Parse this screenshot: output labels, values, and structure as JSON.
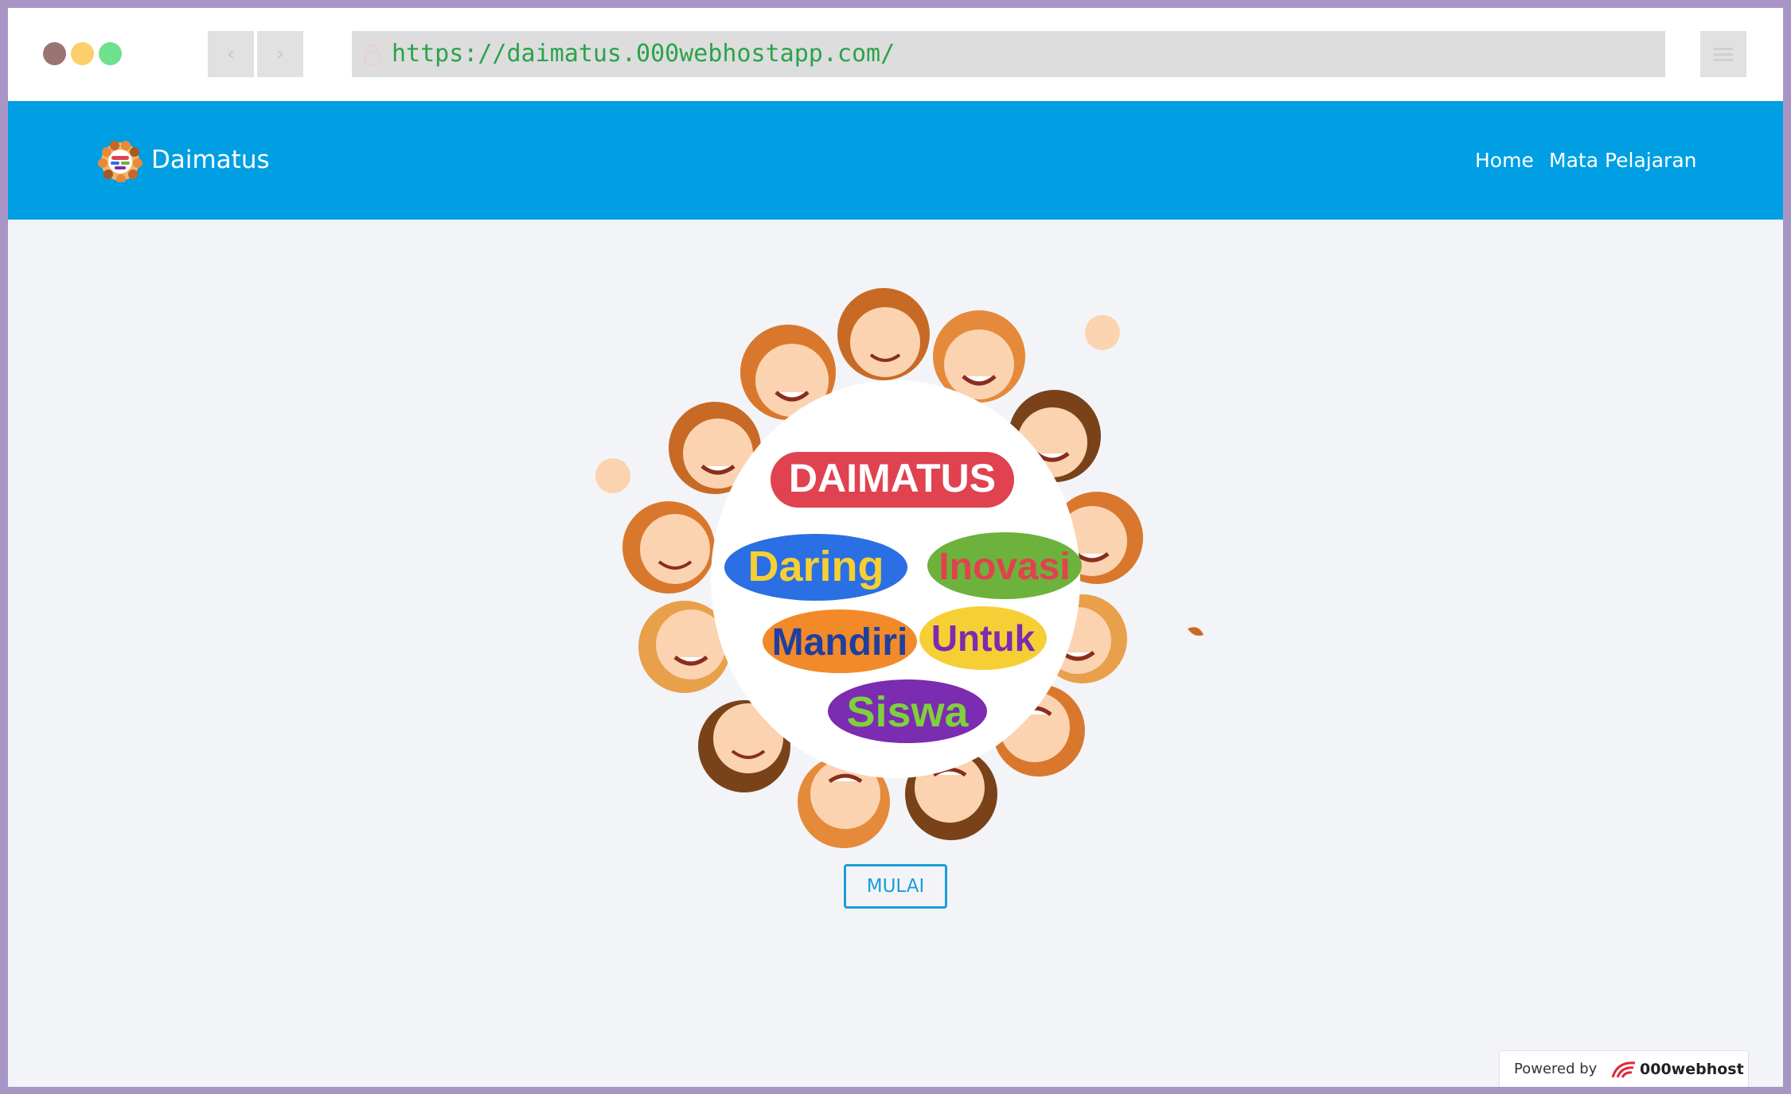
{
  "browser": {
    "url": "https://daimatus.000webhostapp.com/",
    "back_icon": "‹",
    "forward_icon": "›"
  },
  "navbar": {
    "brand": "Daimatus",
    "links": [
      {
        "label": "Home"
      },
      {
        "label": "Mata Pelajaran"
      }
    ],
    "color": "#009fe3"
  },
  "hero": {
    "title": "DAIMATUS",
    "words": [
      "Daring",
      "Inovasi",
      "Mandiri",
      "Untuk",
      "Siswa"
    ]
  },
  "cta": {
    "label": "MULAI",
    "color": "#1a9ddb"
  },
  "footer_badge": {
    "prefix": "Powered by",
    "brand": "000webhost"
  }
}
